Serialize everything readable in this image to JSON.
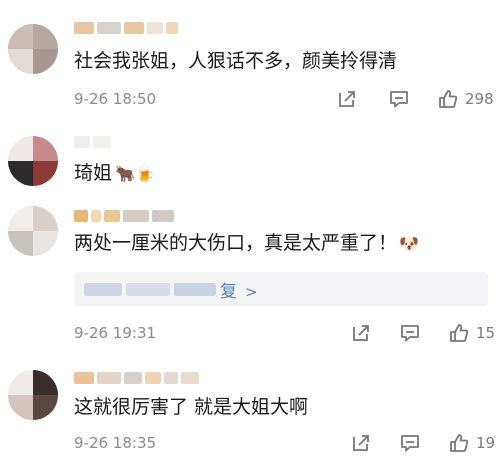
{
  "comments": [
    {
      "text": "社会我张姐，人狠话不多，颜美拎得清",
      "time": "9-26 18:50",
      "likes": "298",
      "emoji": ""
    },
    {
      "text": "琦姐",
      "time": "",
      "likes": "",
      "emoji": "🐂🍺"
    },
    {
      "text": "两处一厘米的大伤口，真是太严重了！",
      "time": "9-26 19:31",
      "likes": "15",
      "emoji": "🐶",
      "reply_text": "复"
    },
    {
      "text": "这就很厉害了 就是大姐大啊",
      "time": "9-26 18:35",
      "likes": "19",
      "emoji": ""
    }
  ],
  "icons": {
    "share": "share-icon",
    "comment": "comment-icon",
    "like": "thumbs-up-icon",
    "chevron": "chevron-right-icon"
  },
  "colors": {
    "text": "#1a1a1a",
    "meta": "#8a8a8a",
    "link": "#5b7fa6",
    "reply_bg": "#f4f4f6"
  }
}
